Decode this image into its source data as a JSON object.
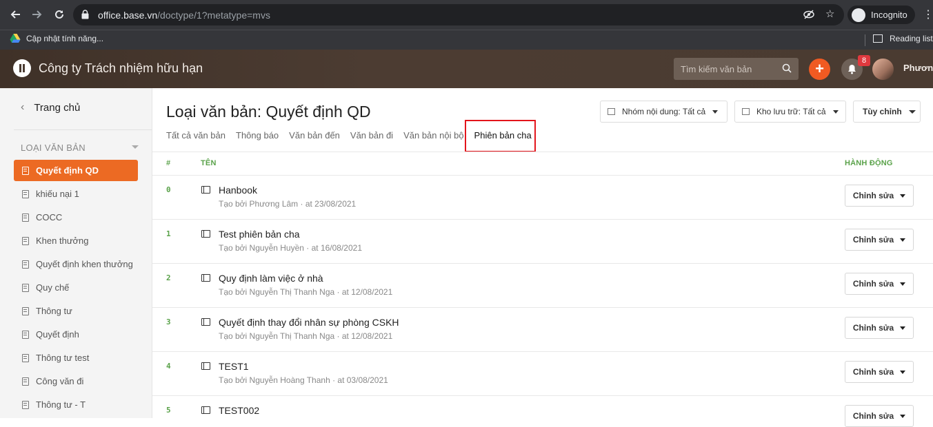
{
  "browser": {
    "url_host": "office.base.vn",
    "url_path": "/doctype/1?metatype=mvs",
    "incognito_label": "Incognito",
    "bookmark_label": "Cập nhật tính năng...",
    "reading_list_label": "Reading list"
  },
  "header": {
    "company": "Công ty Trách nhiệm hữu hạn",
    "search_placeholder": "Tìm kiếm văn bản",
    "notification_count": "8",
    "user_name": "Phương"
  },
  "sidebar": {
    "home": "Trang chủ",
    "section_title": "LOẠI VĂN BẢN",
    "items": [
      {
        "label": "Quyết định QD",
        "active": true
      },
      {
        "label": "khiếu nại 1"
      },
      {
        "label": "COCC"
      },
      {
        "label": "Khen thưởng"
      },
      {
        "label": "Quyết định khen thưởng"
      },
      {
        "label": "Quy chế"
      },
      {
        "label": "Thông tư"
      },
      {
        "label": "Quyết định"
      },
      {
        "label": "Thông tư test"
      },
      {
        "label": "Công văn đi"
      },
      {
        "label": "Thông tư - T"
      }
    ]
  },
  "main": {
    "title": "Loại văn bản: Quyết định QD",
    "tabs": [
      "Tất cả văn bản",
      "Thông báo",
      "Văn bản đến",
      "Văn bản đi",
      "Văn bản nội bộ",
      "Phiên bản cha"
    ],
    "active_tab": "Phiên bản cha",
    "filters": {
      "group": "Nhóm nội dung: Tất cả",
      "storage": "Kho lưu trữ: Tất cả",
      "custom": "Tùy chỉnh"
    },
    "columns": {
      "index": "#",
      "name": "TÊN",
      "action": "HÀNH ĐỘNG"
    },
    "rows": [
      {
        "index": "0",
        "title": "Hanbook",
        "meta": "Tạo bởi Phương Lâm · at 23/08/2021",
        "action": "Chỉnh sửa"
      },
      {
        "index": "1",
        "title": "Test phiên bản cha",
        "meta": "Tạo bởi Nguyễn Huyền · at 16/08/2021",
        "action": "Chỉnh sửa"
      },
      {
        "index": "2",
        "title": "Quy định làm việc ở nhà",
        "meta": "Tạo bởi Nguyễn Thị Thanh Nga · at 12/08/2021",
        "action": "Chỉnh sửa"
      },
      {
        "index": "3",
        "title": "Quyết định thay đổi nhân sự phòng CSKH",
        "meta": "Tạo bởi Nguyễn Thị Thanh Nga · at 12/08/2021",
        "action": "Chỉnh sửa"
      },
      {
        "index": "4",
        "title": "TEST1",
        "meta": "Tạo bởi Nguyễn Hoàng Thanh · at 03/08/2021",
        "action": "Chỉnh sửa"
      },
      {
        "index": "5",
        "title": "TEST002",
        "meta": "",
        "action": "Chỉnh sửa"
      }
    ]
  },
  "colors": {
    "accent": "#ec6a23",
    "header_bg": "#4a3b31",
    "index_green": "#5aa24a",
    "highlight_red": "#e3141b"
  }
}
